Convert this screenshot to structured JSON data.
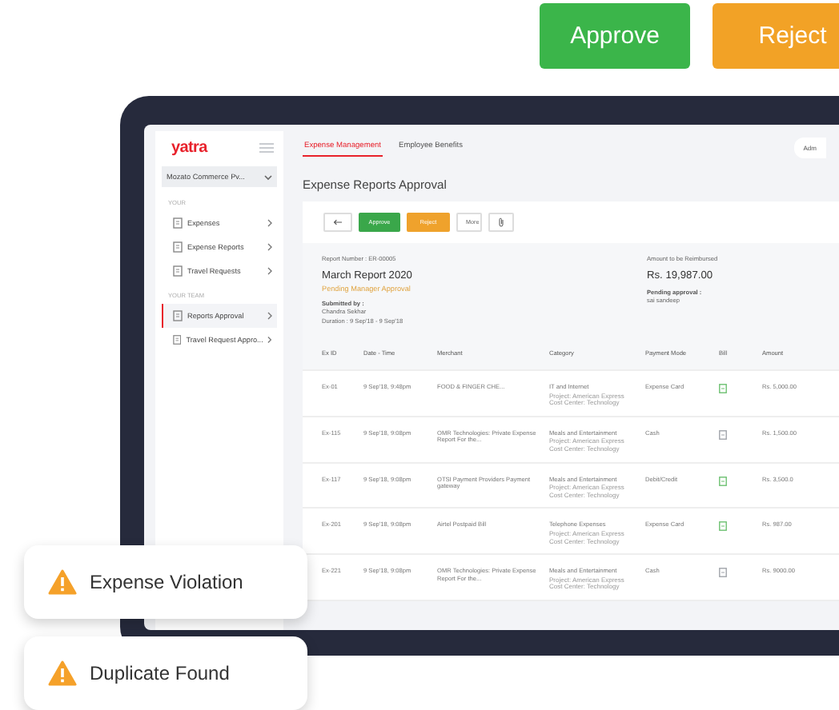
{
  "top_actions": [
    {
      "label": "Approve",
      "kind": "approve"
    },
    {
      "label": "Reject",
      "kind": "reject"
    }
  ],
  "app": {
    "logo": "yatra",
    "company": "Mozato Commerce Pv...",
    "sidebar": [
      {
        "heading": "YOUR",
        "items": [
          {
            "label": "Expenses",
            "selected": false
          },
          {
            "label": "Expense Reports",
            "selected": false
          },
          {
            "label": "Travel Requests",
            "selected": false
          }
        ]
      },
      {
        "heading": "YOUR TEAM",
        "items": [
          {
            "label": "Reports Approval",
            "selected": true
          },
          {
            "label": "Travel Request Appro...",
            "selected": false
          }
        ]
      }
    ],
    "tabs": [
      {
        "label": "Expense Management",
        "selected": true
      },
      {
        "label": "Employee Benefits",
        "selected": false
      }
    ],
    "user_button": "Adm",
    "page_title": "Expense Reports Approval",
    "toolbar": [
      {
        "kind": "back"
      },
      {
        "kind": "approve",
        "label": "Approve"
      },
      {
        "kind": "reject",
        "label": "Reject"
      },
      {
        "kind": "more",
        "label": "More"
      },
      {
        "kind": "attach"
      }
    ],
    "report": {
      "number": "Report Number : ER-00005",
      "title": "March Report 2020",
      "status": "Pending Manager Approval",
      "submitted_label": "Submitted by :",
      "submitted_by": "Chandra Sekhar",
      "duration": "Duration : 9 Sep'18 - 9 Sep'18",
      "amount_label": "Amount to be Reimbursed",
      "amount": "Rs. 19,987.00",
      "pending_label": "Pending approval :",
      "pending_by": "sai sandeep"
    },
    "table": {
      "columns": [
        "Ex ID",
        "Date - Time",
        "Merchant",
        "Category",
        "Payment Mode",
        "Bill",
        "Amount"
      ],
      "rows": [
        {
          "id": "Ex-01",
          "date": "9 Sep'18, 9:48pm",
          "merchant": "FOOD & FINGER CHE...",
          "category": "IT and Internet",
          "project": "Project: American Express",
          "cost_center": "Cost Center: Technology",
          "payment": "Expense Card",
          "bill": {
            "color": "#6cc070"
          },
          "amount": "Rs. 5,000.00"
        },
        {
          "id": "Ex-115",
          "date": "9 Sep'18, 9:08pm",
          "merchant": "OMR Technologies: Private Expense Report For the...",
          "category": "Meals and Entertainment",
          "project": "Project: American Express",
          "cost_center": "Cost Center: Technology",
          "payment": "Cash",
          "bill": {
            "color": "#a0a4aa"
          },
          "amount": "Rs. 1,500.00"
        },
        {
          "id": "Ex-117",
          "date": "9 Sep'18, 9:08pm",
          "merchant": "OTSI Payment Providers Payment gateway",
          "category": "Meals and Entertainment",
          "project": "Project: American Express",
          "cost_center": "Cost Center: Technology",
          "payment": "Debit/Credit",
          "bill": {
            "color": "#6cc070"
          },
          "amount": "Rs. 3,500.0"
        },
        {
          "id": "Ex-201",
          "date": "9 Sep'18, 9:08pm",
          "merchant": "Airtel Postpaid Bill",
          "category": "Telephone Expenses",
          "project": "Project: American Express",
          "cost_center": "Cost Center: Technology",
          "payment": "Expense Card",
          "bill": {
            "color": "#6cc070"
          },
          "amount": "Rs. 987.00"
        },
        {
          "id": "Ex-221",
          "date": "9 Sep'18, 9:08pm",
          "merchant": "OMR Technologies: Private Expense Report For the...",
          "category": "Meals and Entertainment",
          "project": "Project: American Express",
          "cost_center": "Cost Center: Technology",
          "payment": "Cash",
          "bill": {
            "color": "#a0a4aa"
          },
          "amount": "Rs. 9000.00"
        }
      ]
    }
  },
  "alerts": [
    {
      "label": "Expense Violation"
    },
    {
      "label": "Duplicate Found"
    }
  ]
}
